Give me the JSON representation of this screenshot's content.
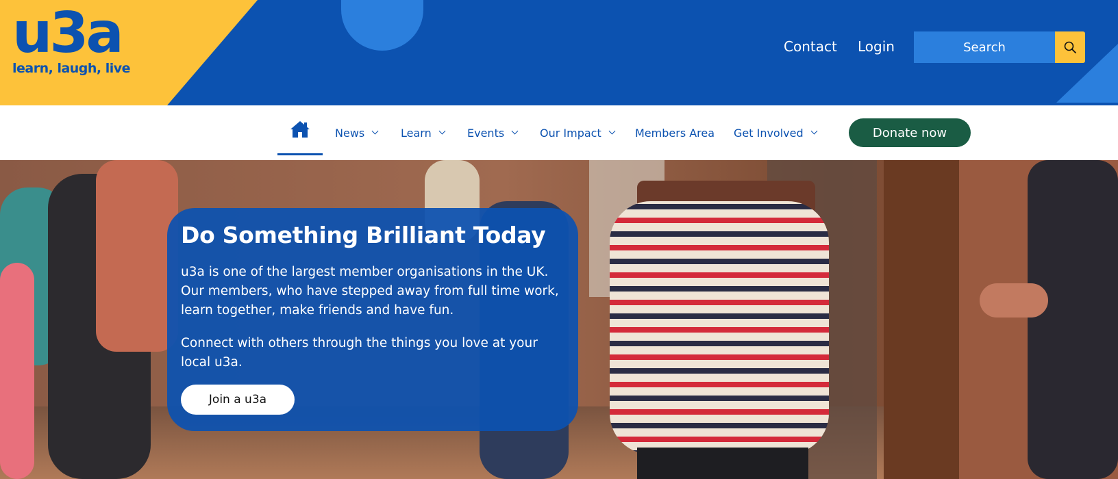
{
  "brand": {
    "logo_text": "u3a",
    "tagline": "learn, laugh, live",
    "colors": {
      "primary_blue": "#0c52b0",
      "light_blue": "#2b7fdd",
      "yellow": "#fdc23a",
      "green": "#1a5c44"
    }
  },
  "header": {
    "links": [
      {
        "label": "Contact"
      },
      {
        "label": "Login"
      }
    ],
    "search": {
      "placeholder": "Search",
      "button_icon": "search-icon"
    }
  },
  "nav": {
    "home_icon": "home-icon",
    "items": [
      {
        "label": "News",
        "has_dropdown": true
      },
      {
        "label": "Learn",
        "has_dropdown": true
      },
      {
        "label": "Events",
        "has_dropdown": true
      },
      {
        "label": "Our Impact",
        "has_dropdown": true
      },
      {
        "label": "Members Area",
        "has_dropdown": false
      },
      {
        "label": "Get Involved",
        "has_dropdown": true
      }
    ],
    "donate_label": "Donate now"
  },
  "hero": {
    "title": "Do Something Brilliant Today",
    "paragraph1": "u3a is one of the largest member organisations in the UK. Our members, who have stepped away from full time work, learn together, make friends and have fun.",
    "paragraph2": "Connect with others through the things you love at your local u3a.",
    "cta_label": "Join a u3a"
  }
}
